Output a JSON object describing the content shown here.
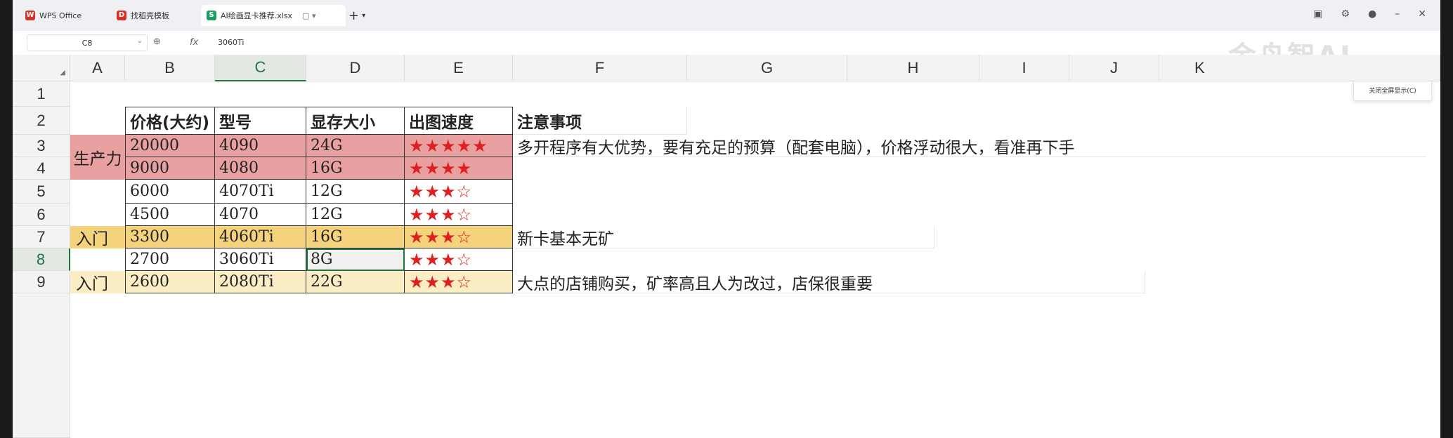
{
  "tabs": [
    {
      "label": "WPS Office",
      "logo": "W",
      "color": "#d93025"
    },
    {
      "label": "找稻壳模板",
      "logo": "D",
      "color": "#d93025"
    },
    {
      "label": "AI绘画显卡推荐.xlsx",
      "logo": "S",
      "color": "#1e9d62"
    }
  ],
  "tab_plus": "+",
  "formula": {
    "cell_ref": "C8",
    "fx": "fx",
    "value": "3060Ti"
  },
  "watermark": "金舟智AI",
  "tooltip": "关闭全屏显示(C)",
  "columns": [
    "A",
    "B",
    "C",
    "D",
    "E",
    "F",
    "G",
    "H",
    "I",
    "J",
    "K"
  ],
  "rows": [
    "1",
    "2",
    "3",
    "4",
    "5",
    "6",
    "7",
    "8",
    "9"
  ],
  "table_header": {
    "price": "价格(大约)",
    "model": "型号",
    "vram": "显存大小",
    "speed": "出图速度",
    "notes": "注意事项"
  },
  "labels": {
    "productivity": "生产力",
    "entry1": "入门",
    "entry2": "入门"
  },
  "table_rows": [
    {
      "price": "20000",
      "model": "4090",
      "vram": "24G",
      "stars": "★★★★★",
      "half": ""
    },
    {
      "price": "9000",
      "model": "4080",
      "vram": "16G",
      "stars": "★★★★",
      "half": ""
    },
    {
      "price": "6000",
      "model": "4070Ti",
      "vram": "12G",
      "stars": "★★★",
      "half": "☆"
    },
    {
      "price": "4500",
      "model": "4070",
      "vram": "12G",
      "stars": "★★★",
      "half": "☆"
    },
    {
      "price": "3300",
      "model": "4060Ti",
      "vram": "16G",
      "stars": "★★★",
      "half": "☆"
    },
    {
      "price": "2700",
      "model": "3060Ti",
      "vram": "8G",
      "stars": "★★★",
      "half": "☆"
    },
    {
      "price": "2600",
      "model": "2080Ti",
      "vram": "22G",
      "stars": "★★★",
      "half": "☆"
    }
  ],
  "notes": {
    "row3": "多开程序有大优势，要有充足的预算（配套电脑），价格浮动很大，看准再下手",
    "row7": "新卡基本无矿",
    "row9": "大点的店铺购买，矿率高且人为改过，店保很重要"
  },
  "colors": {
    "red_fill": "#e8a0a0",
    "orange_fill": "#f5d27c",
    "cream_fill": "#fbeec4",
    "selection": "#217346",
    "stars": "#e02020"
  }
}
